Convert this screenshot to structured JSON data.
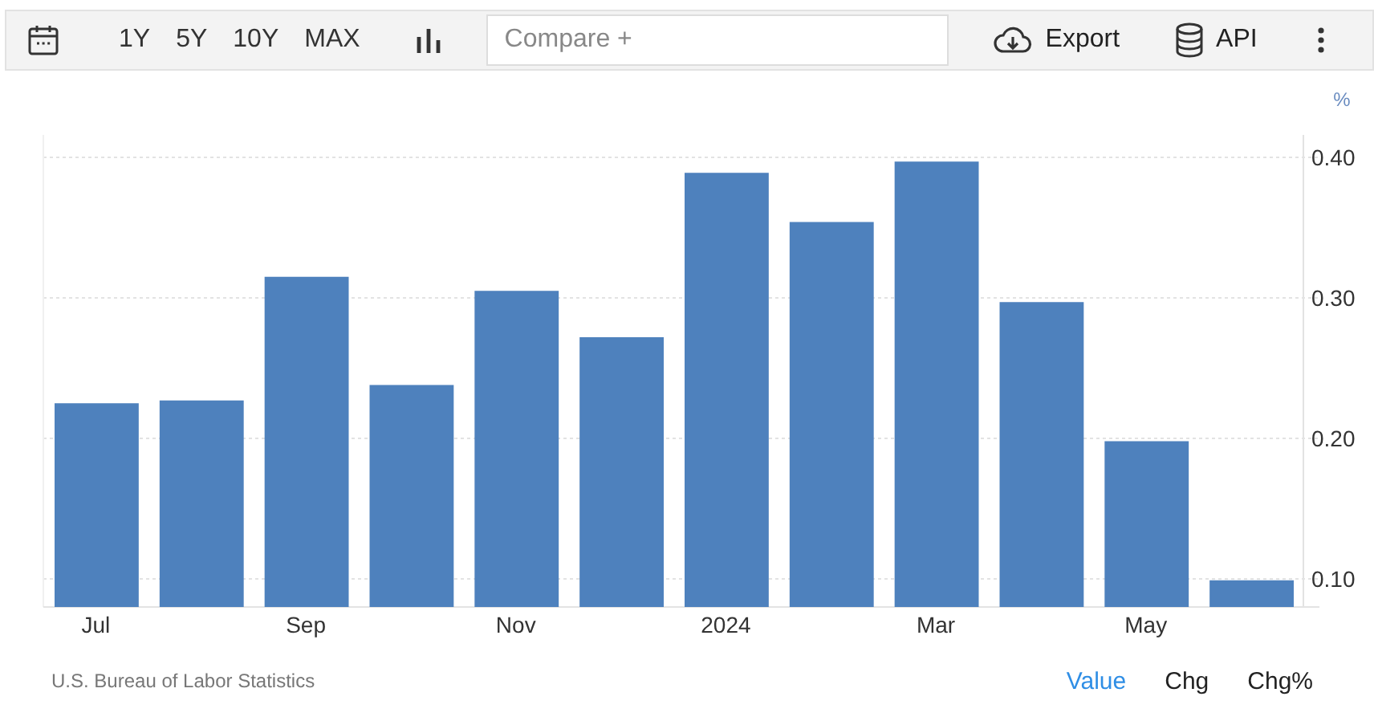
{
  "toolbar": {
    "ranges": [
      {
        "label": "1Y",
        "selected": false
      },
      {
        "label": "5Y",
        "selected": false
      },
      {
        "label": "10Y",
        "selected": false
      },
      {
        "label": "MAX",
        "selected": false
      }
    ],
    "compare": {
      "placeholder": "Compare +"
    },
    "actions": [
      {
        "label": "Export",
        "kind": "export"
      },
      {
        "label": "API",
        "kind": "api"
      }
    ]
  },
  "chart": {
    "unit": "%",
    "chart_data": {
      "type": "bar",
      "grid": true,
      "ylim": [
        0.08,
        0.416
      ],
      "yticks": [
        {
          "value": 0.1,
          "label": "0.10"
        },
        {
          "value": 0.2,
          "label": "0.20"
        },
        {
          "value": 0.3,
          "label": "0.30"
        },
        {
          "value": 0.4,
          "label": "0.40"
        }
      ],
      "categories": [
        "Jul",
        null,
        "Sep",
        null,
        "Nov",
        null,
        "2024",
        null,
        "Mar",
        null,
        "May",
        null
      ],
      "values": [
        0.225,
        0.227,
        0.315,
        0.238,
        0.305,
        0.272,
        0.389,
        0.354,
        0.397,
        0.297,
        0.198,
        0.099
      ]
    }
  },
  "footer": {
    "source": "U.S. Bureau of Labor Statistics",
    "modes": [
      {
        "label": "Value",
        "selected": true
      },
      {
        "label": "Chg",
        "selected": false
      },
      {
        "label": "Chg%",
        "selected": false
      }
    ]
  }
}
